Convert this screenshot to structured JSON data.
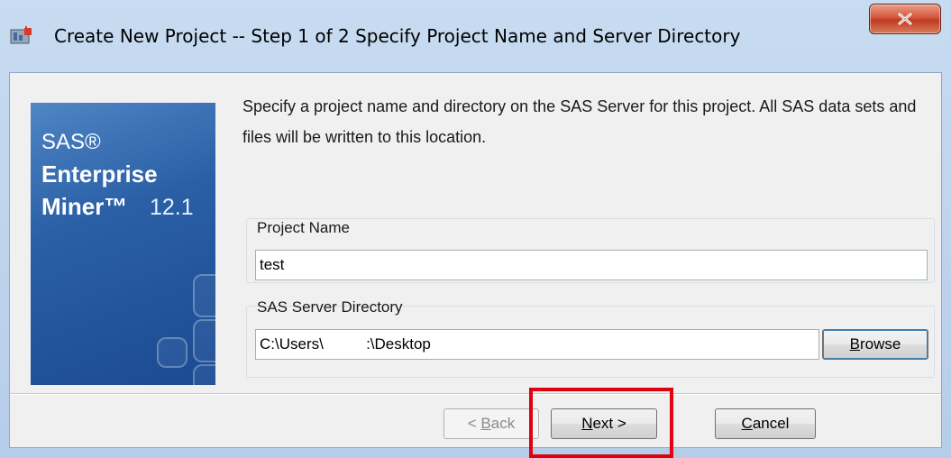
{
  "window": {
    "title": "Create New Project  -- Step 1 of 2  Specify Project Name and Server Directory"
  },
  "banner": {
    "brand_sas": "SAS®",
    "brand_enterprise": "Enterprise",
    "brand_miner": "Miner™",
    "version": "12.1"
  },
  "intro_text": "Specify a project name and directory on the SAS Server for this project. All SAS data sets and files will be written to this location.",
  "project_name": {
    "label": "Project Name",
    "value": "test"
  },
  "server_directory": {
    "label": "SAS Server Directory",
    "value": "C:\\Users\\          :\\Desktop",
    "browse_label_prefix": "",
    "browse_mnemonic": "B",
    "browse_label_rest": "rowse"
  },
  "buttons": {
    "back_prefix": "< ",
    "back_mnemonic": "B",
    "back_rest": "ack",
    "next_mnemonic": "N",
    "next_rest": "ext >",
    "cancel_mnemonic": "C",
    "cancel_rest": "ancel"
  },
  "colors": {
    "accent_highlight": "#e0000f",
    "close_button": "#c9402a",
    "banner_blue": "#2a5fa6"
  },
  "icons": [
    "app-icon",
    "close-icon"
  ]
}
